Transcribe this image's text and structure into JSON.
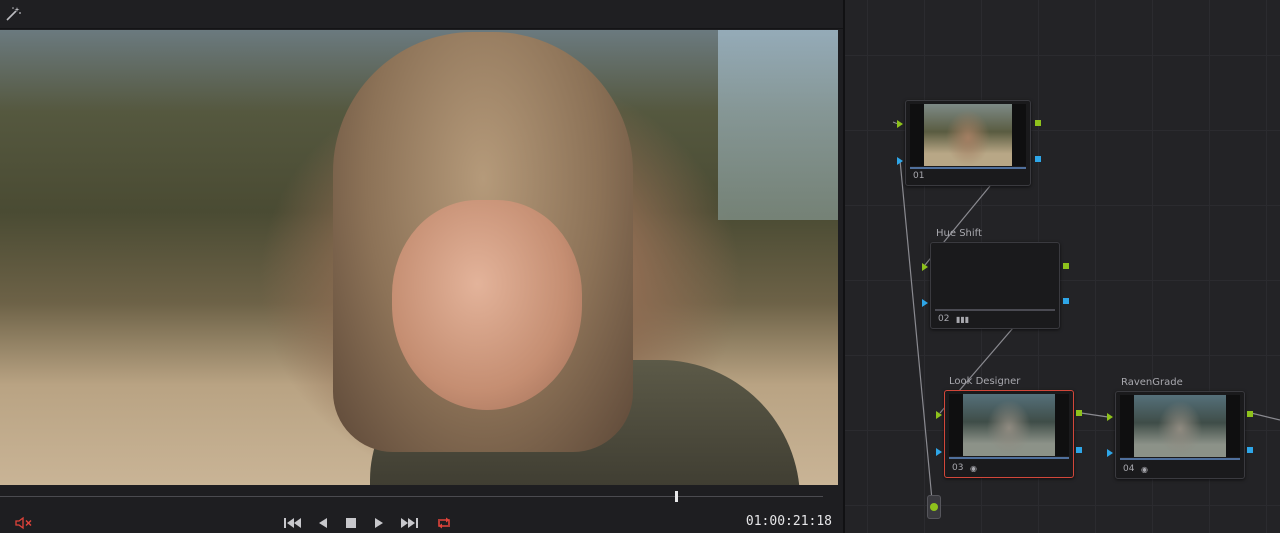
{
  "viewer": {
    "timecode": "01:00:21:18",
    "playhead_fraction": 0.82,
    "icons": {
      "magic": "magic-wand-icon",
      "mute": "speaker-muted-icon",
      "first": "skip-to-start-icon",
      "back": "play-reverse-icon",
      "stop": "stop-icon",
      "play": "play-icon",
      "last": "skip-to-end-icon",
      "loop": "loop-icon"
    },
    "colors": {
      "mute": "#e0433a",
      "loop": "#e0433a"
    }
  },
  "nodes": [
    {
      "num": "01",
      "label": "",
      "thumb": "warm",
      "selected": false
    },
    {
      "num": "02",
      "label": "Hue Shift",
      "thumb": "none",
      "selected": false
    },
    {
      "num": "03",
      "label": "Look Designer",
      "thumb": "cool",
      "selected": true
    },
    {
      "num": "04",
      "label": "RavenGrade",
      "thumb": "cool",
      "selected": false
    }
  ],
  "colors": {
    "port_green": "#8ec21c",
    "port_blue": "#2ea6e8",
    "selection": "#d2473a"
  }
}
